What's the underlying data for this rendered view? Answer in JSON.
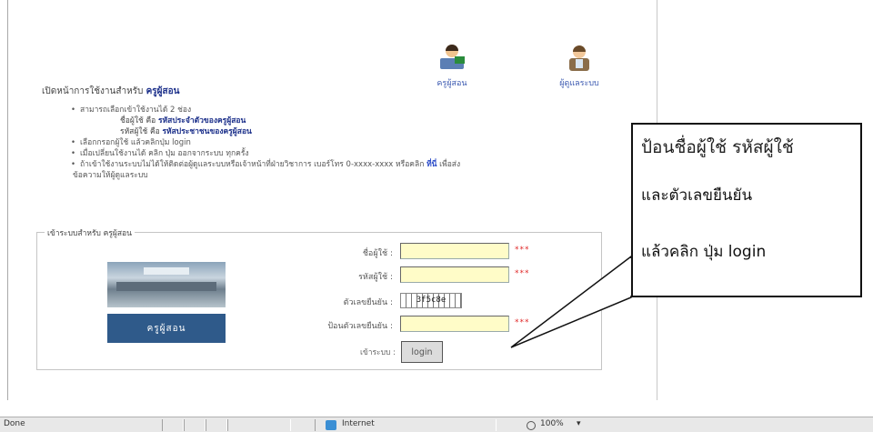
{
  "header": {
    "teacher_label": "ครูผู้สอน",
    "admin_label": "ผู้ดูแลระบบ"
  },
  "intro": {
    "prefix": "เปิดหน้าการใช้งานสำหรับ ",
    "emphasis": "ครูผู้สอน"
  },
  "instructions": {
    "line1": "สามารถเลือกเข้าใช้งานได้ 2 ช่อง",
    "line2_prefix": "ชื่อผู้ใช้ คือ ",
    "line2_bold": "รหัสประจำตัวของครูผู้สอน",
    "line3_prefix": "รหัสผู้ใช้ คือ ",
    "line3_bold": "รหัสประชาชนของครูผู้สอน",
    "line4": "เลือกกรอกผู้ใช้ แล้วคลิกปุ่ม login",
    "line5": "เมื่อเปลี่ยนใช้งานได้ คลิก ปุ่ม ออกจากระบบ ทุกครั้ง",
    "line6_prefix": "ถ้าเข้าใช้งานระบบไม่ได้ให้ติดต่อผู้ดูแลระบบหรือเจ้าหน้าที่ฝ่ายวิชาการ เบอร์โทร 0-xxxx-xxxx หรือคลิก ",
    "line6_link": "ที่นี่",
    "line6_suffix": " เพื่อส่ง",
    "line7": "ข้อความให้ผู้ดูแลระบบ"
  },
  "login_form": {
    "legend": "เข้าระบบสำหรับ ครูผู้สอน",
    "photo_caption": "ครูผู้สอน",
    "username_label": "ชื่อผู้ใช้ :",
    "password_label": "รหัสผู้ใช้ :",
    "captcha_label": "ตัวเลขยืนยัน :",
    "captcha_value": "3f5c8e",
    "confirm_label": "ป้อนตัวเลขยืนยัน :",
    "required_mark": "***",
    "submit_prefix": "เข้าระบบ :",
    "submit_label": "login"
  },
  "callout": {
    "line1": "ป้อนชื่อผู้ใช้ รหัสผู้ใช้",
    "line2": "และตัวเลขยืนยัน",
    "line3": "แล้วคลิก ปุ่ม login"
  },
  "statusbar": {
    "status_text": "Done",
    "zone_text": "Internet",
    "zoom_text": "100%"
  },
  "colors": {
    "input_bg": "#fffcc8",
    "required": "#e02828",
    "link": "#2b4bc8"
  }
}
